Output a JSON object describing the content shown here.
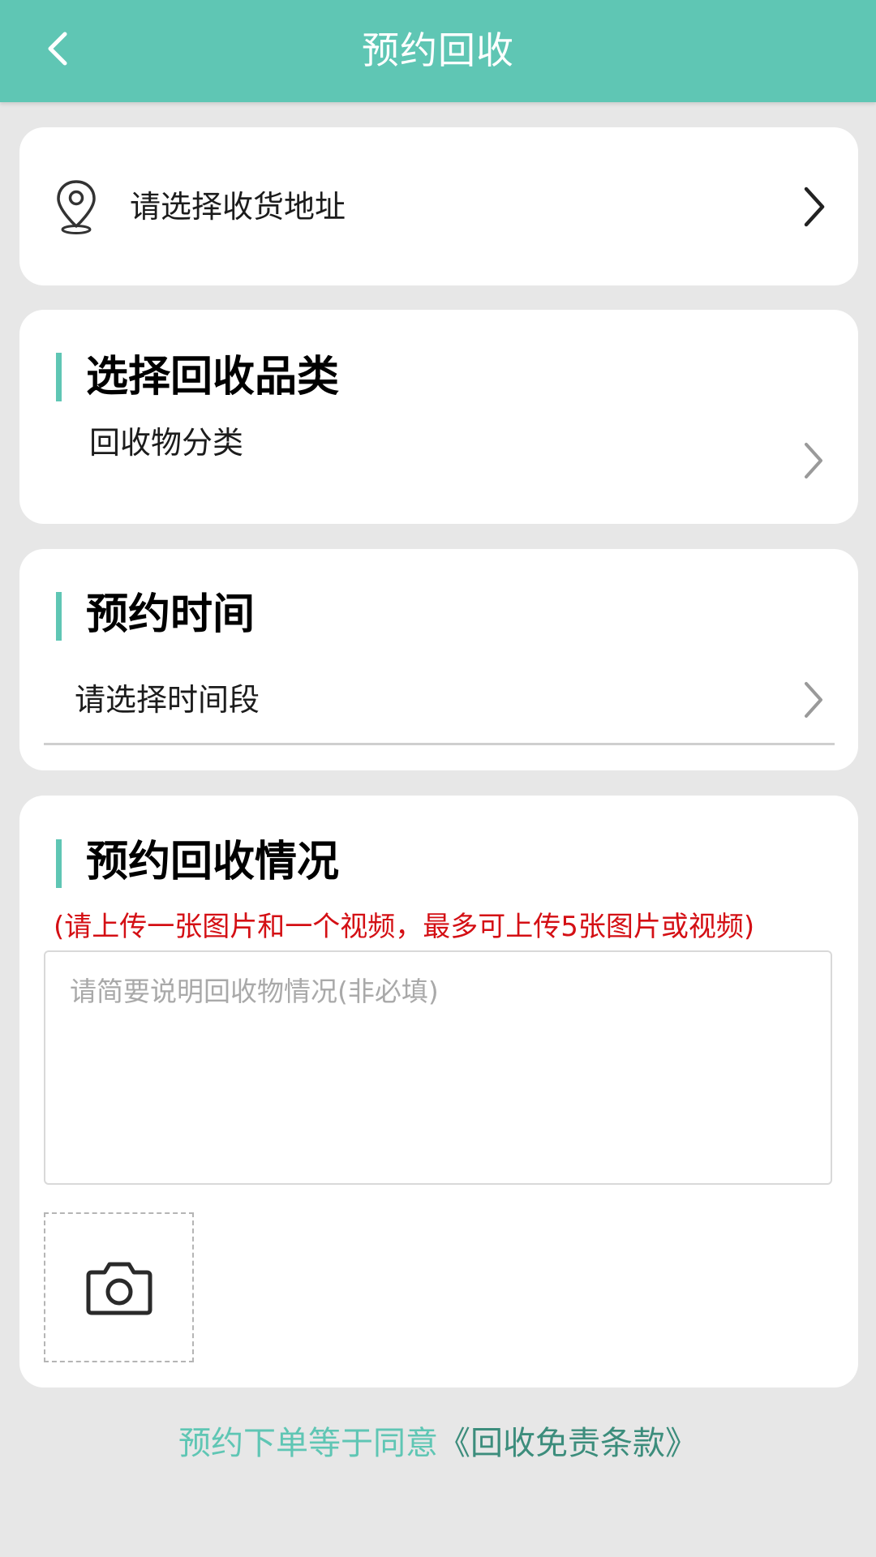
{
  "header": {
    "title": "预约回收",
    "back_icon": "chevron-left-icon",
    "background_color": "#5fc6b4"
  },
  "address": {
    "icon": "location-pin-icon",
    "placeholder": "请选择收货地址",
    "chevron_icon": "chevron-right-icon"
  },
  "category_section": {
    "title": "选择回收品类",
    "subtitle": "回收物分类",
    "chevron_icon": "chevron-right-icon"
  },
  "time_section": {
    "title": "预约时间",
    "placeholder": "请选择时间段",
    "chevron_icon": "chevron-right-icon"
  },
  "condition_section": {
    "title": "预约回收情况",
    "notice": "(请上传一张图片和一个视频，最多可上传5张图片或视频)",
    "notice_color": "#d40f14",
    "description_placeholder": "请简要说明回收物情况(非必填)",
    "upload_icon": "camera-icon"
  },
  "footer": {
    "agreement_prefix": "预约下单等于同意",
    "agreement_link": "《回收免责条款》"
  },
  "colors": {
    "accent": "#5fc6b4",
    "page_background": "#e7e7e7",
    "link": "#3c8d7c"
  }
}
